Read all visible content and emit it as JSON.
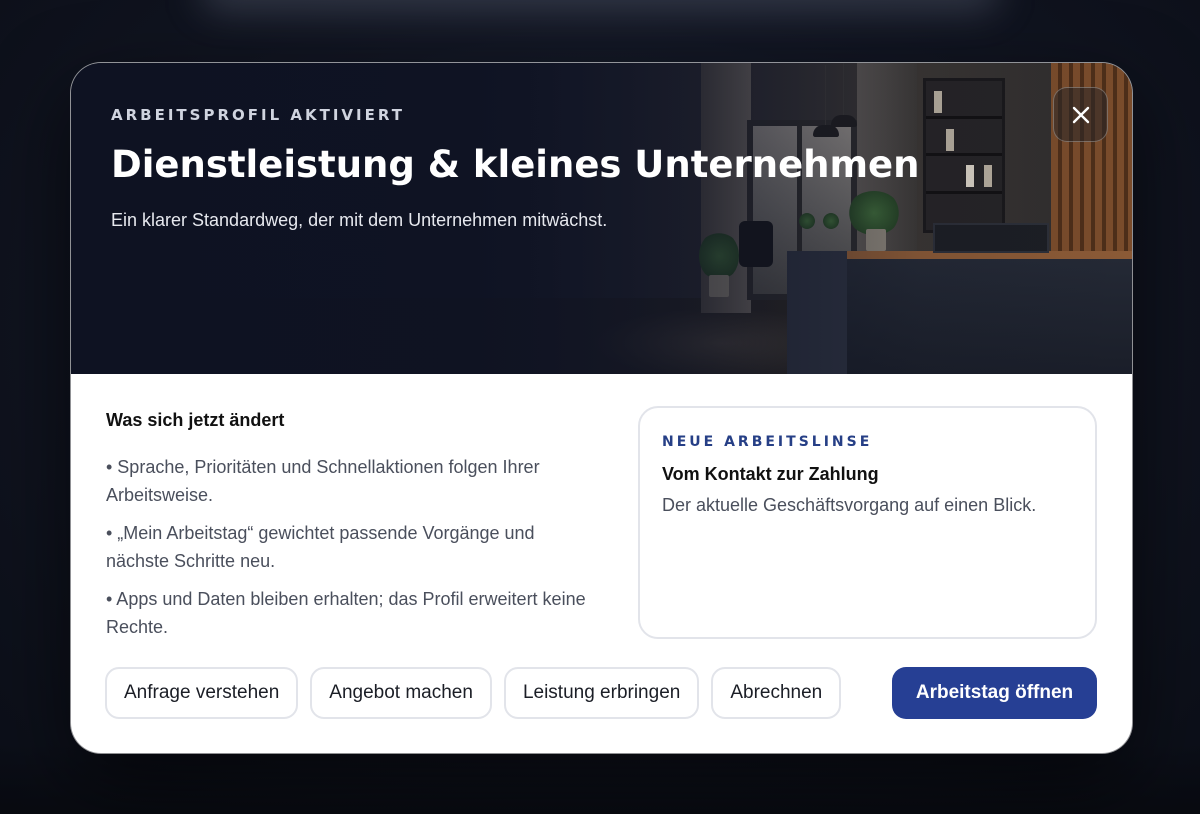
{
  "dialog": {
    "eyebrow": "ARBEITSPROFIL AKTIVIERT",
    "title": "Dienstleistung & kleines Unternehmen",
    "subtitle": "Ein klarer Standardweg, der mit dem Unternehmen mitwächst.",
    "close_icon": "close-icon"
  },
  "changes": {
    "title": "Was sich jetzt ändert",
    "items": [
      "• Sprache, Prioritäten und Schnellaktionen folgen Ihrer Arbeitsweise.",
      "• „Mein Arbeitstag“ gewichtet passende Vorgänge und nächste Schritte neu.",
      "• Apps und Daten bleiben erhalten; das Profil erweitert keine Rechte."
    ]
  },
  "lens": {
    "eyebrow": "NEUE ARBEITSLINSE",
    "title": "Vom Kontakt zur Zahlung",
    "description": "Der aktuelle Geschäftsvorgang auf einen Blick."
  },
  "actions": {
    "steps": [
      "Anfrage verstehen",
      "Angebot machen",
      "Leistung erbringen",
      "Abrechnen"
    ],
    "primary": "Arbeitstag öffnen"
  },
  "colors": {
    "accent": "#263f94",
    "eyebrow_blue": "#263f86"
  }
}
